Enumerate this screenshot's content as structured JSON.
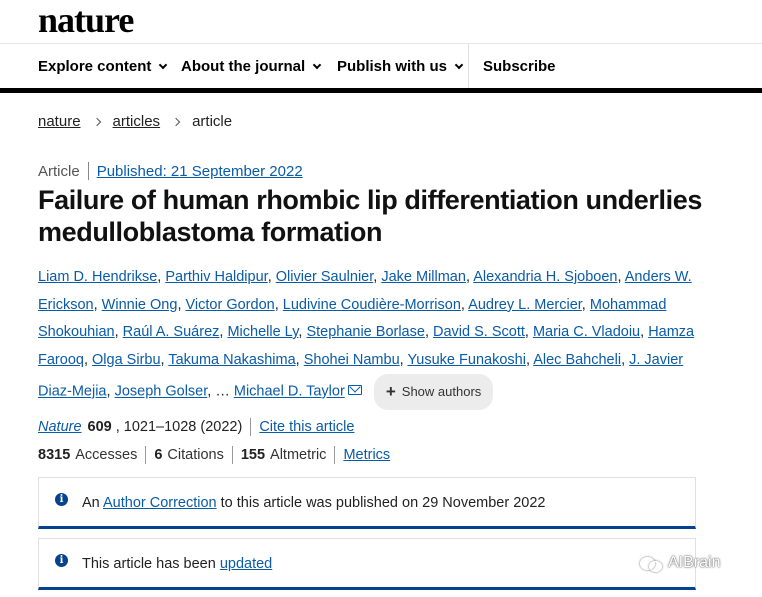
{
  "header": {
    "logo": "nature"
  },
  "nav": {
    "items": [
      {
        "label": "Explore content"
      },
      {
        "label": "About the journal"
      },
      {
        "label": "Publish with us"
      }
    ],
    "subscribe": "Subscribe"
  },
  "breadcrumb": {
    "items": [
      "nature",
      "articles",
      "article"
    ]
  },
  "article": {
    "type": "Article",
    "published": "Published: 21 September 2022",
    "title": "Failure of human rhombic lip differentiation underlies medulloblastoma formation",
    "authors": [
      "Liam D. Hendrikse",
      "Parthiv Haldipur",
      "Olivier Saulnier",
      "Jake Millman",
      "Alexandria H. Sjoboen",
      "Anders W. Erickson",
      "Winnie Ong",
      "Victor Gordon",
      "Ludivine Coudière-Morrison",
      "Audrey L. Mercier",
      "Mohammad Shokouhian",
      "Raúl A. Suárez",
      "Michelle Ly",
      "Stephanie Borlase",
      "David S. Scott",
      "Maria C. Vladoiu",
      "Hamza Farooq",
      "Olga Sirbu",
      "Takuma Nakashima",
      "Shohei Nambu",
      "Yusuke Funakoshi",
      "Alec Bahcheli",
      "J. Javier Diaz-Mejia",
      "Joseph Golser"
    ],
    "ellipsis": "…",
    "last_author": "Michael D. Taylor",
    "show_authors": "Show authors",
    "journal": "Nature",
    "volume": "609",
    "pages": ", 1021–1028 (2022)",
    "cite": "Cite this article",
    "accesses_count": "8315",
    "accesses_label": "Accesses",
    "citations_count": "6",
    "citations_label": "Citations",
    "altmetric_count": "155",
    "altmetric_label": "Altmetric",
    "metrics_link": "Metrics"
  },
  "notices": {
    "correction_prefix": "An",
    "correction_link": "Author Correction",
    "correction_suffix": "to this article was published on 29 November 2022",
    "updated_prefix": "This article has been",
    "updated_link": "updated"
  },
  "watermark": {
    "text": "AIBrain"
  },
  "colors": {
    "link": "#0a5ba8",
    "notice_border": "#06438f",
    "text": "#222222"
  }
}
